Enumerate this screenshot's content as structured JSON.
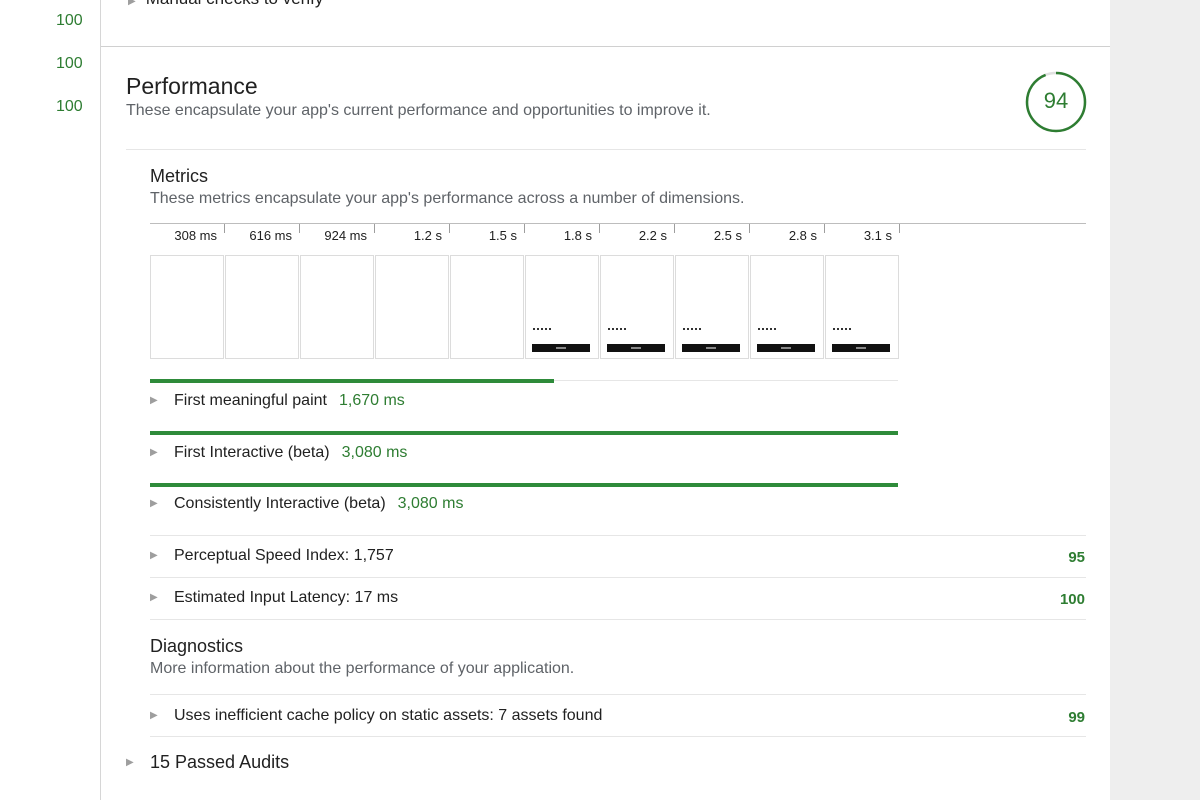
{
  "side_scores": [
    "100",
    "100",
    "100"
  ],
  "cutoff_row": {
    "label": "Manual checks to verify"
  },
  "performance": {
    "title": "Performance",
    "description": "These encapsulate your app's current performance and opportunities to improve it.",
    "score": "94",
    "score_fraction": 0.94,
    "score_color": "#2e7d32"
  },
  "metrics": {
    "title": "Metrics",
    "description": "These metrics encapsulate your app's performance across a number of dimensions.",
    "timeline": [
      "308 ms",
      "616 ms",
      "924 ms",
      "1.2 s",
      "1.5 s",
      "1.8 s",
      "2.2 s",
      "2.5 s",
      "2.8 s",
      "3.1 s"
    ],
    "frames_rendered": [
      false,
      false,
      false,
      false,
      false,
      true,
      true,
      true,
      true,
      true
    ],
    "items": [
      {
        "label": "First meaningful paint",
        "value": "1,670 ms",
        "bar_fraction": 0.54
      },
      {
        "label": "First Interactive (beta)",
        "value": "3,080 ms",
        "bar_fraction": 1.0
      },
      {
        "label": "Consistently Interactive (beta)",
        "value": "3,080 ms",
        "bar_fraction": 1.0
      }
    ],
    "scored_items": [
      {
        "label": "Perceptual Speed Index: 1,757",
        "score": "95"
      },
      {
        "label": "Estimated Input Latency: 17 ms",
        "score": "100"
      }
    ]
  },
  "diagnostics": {
    "title": "Diagnostics",
    "description": "More information about the performance of your application.",
    "items": [
      {
        "label": "Uses inefficient cache policy on static assets: 7 assets found",
        "score": "99"
      }
    ]
  },
  "passed_audits": {
    "label": "15 Passed Audits"
  },
  "colors": {
    "pass_green": "#2e7d32",
    "bar_green": "#2e8b3a"
  },
  "icons": {
    "expand": "triangle-right-icon"
  }
}
